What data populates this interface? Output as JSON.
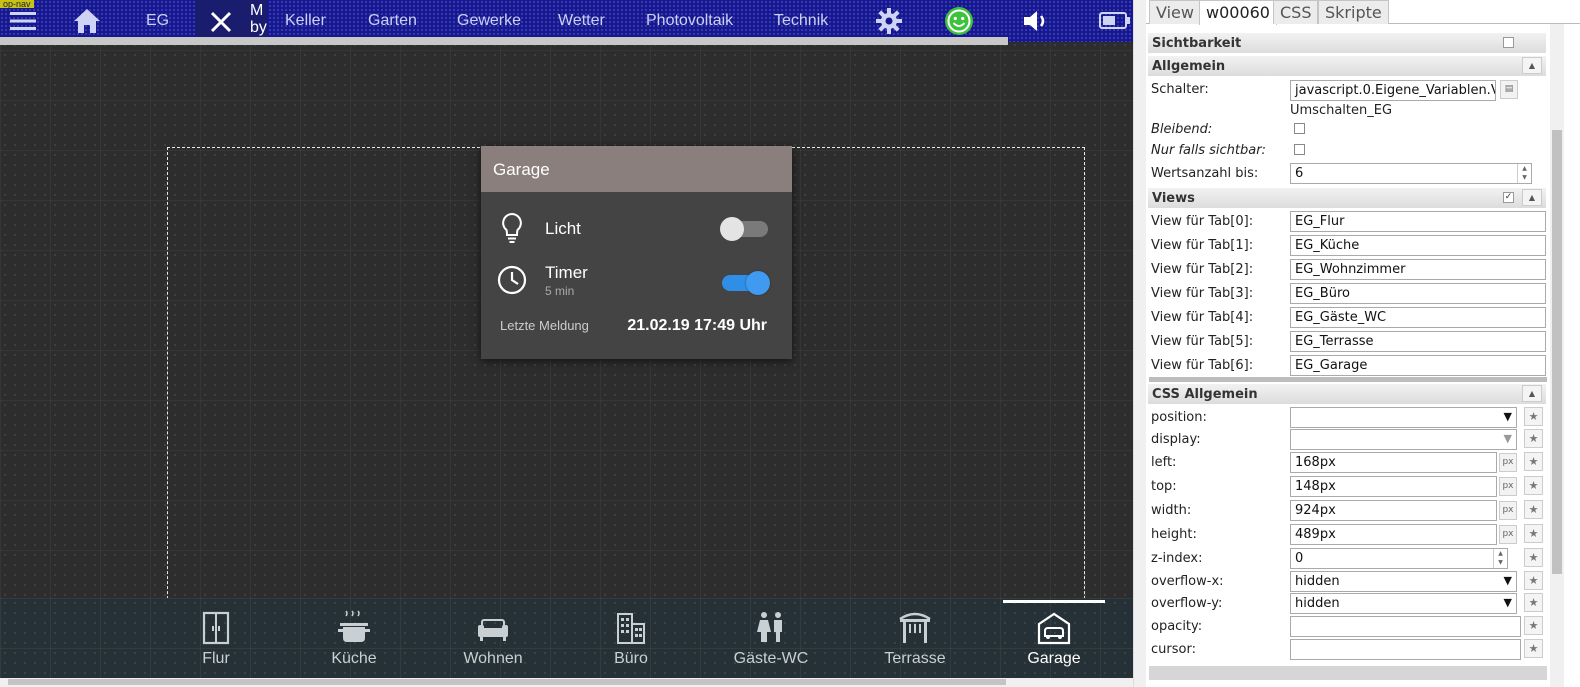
{
  "topnav": {
    "tag": "op-nav",
    "home_label": "EG",
    "close_text_line1": "M",
    "close_text_line2": "by",
    "links": [
      "Keller",
      "Garten",
      "Gewerke",
      "Wetter",
      "Photovoltaik",
      "Technik"
    ]
  },
  "card": {
    "title": "Garage",
    "licht_label": "Licht",
    "licht_on": false,
    "timer_label": "Timer",
    "timer_sub": "5 min",
    "timer_on": true,
    "meldung_label": "Letzte Meldung",
    "meldung_value": "21.02.19 17:49 Uhr"
  },
  "tabbar": {
    "tabs": [
      {
        "label": "Flur",
        "icon": "door-icon"
      },
      {
        "label": "Küche",
        "icon": "cooking-pot-icon"
      },
      {
        "label": "Wohnen",
        "icon": "sofa-icon"
      },
      {
        "label": "Büro",
        "icon": "office-building-icon"
      },
      {
        "label": "Gäste-WC",
        "icon": "restroom-icon"
      },
      {
        "label": "Terrasse",
        "icon": "pergola-icon"
      },
      {
        "label": "Garage",
        "icon": "garage-icon"
      }
    ],
    "active_index": 6
  },
  "panel": {
    "tabs": [
      "View",
      "w00060",
      "CSS",
      "Skripte"
    ],
    "active_tab": 1,
    "sichtbarkeit": "Sichtbarkeit",
    "allgemein": "Allgemein",
    "schalter_label": "Schalter:",
    "schalter_value": "javascript.0.Eigene_Variablen.V",
    "schalter_hint": "Umschalten_EG",
    "bleibend_label": "Bleibend:",
    "nur_sichtbar_label": "Nur falls sichtbar:",
    "wertsanzahl_label": "Wertsanzahl bis:",
    "wertsanzahl_value": "6",
    "views": "Views",
    "view_rows": [
      {
        "label": "View für Tab[0]:",
        "value": "EG_Flur"
      },
      {
        "label": "View für Tab[1]:",
        "value": "EG_Küche"
      },
      {
        "label": "View für Tab[2]:",
        "value": "EG_Wohnzimmer"
      },
      {
        "label": "View für Tab[3]:",
        "value": "EG_Büro"
      },
      {
        "label": "View für Tab[4]:",
        "value": "EG_Gäste_WC"
      },
      {
        "label": "View für Tab[5]:",
        "value": "EG_Terrasse"
      },
      {
        "label": "View für Tab[6]:",
        "value": "EG_Garage"
      }
    ],
    "css_allgemein": "CSS Allgemein",
    "css_rows": [
      {
        "label": "position:",
        "value": ""
      },
      {
        "label": "display:",
        "value": ""
      },
      {
        "label": "left:",
        "value": "168px",
        "unit": "px"
      },
      {
        "label": "top:",
        "value": "148px",
        "unit": "px"
      },
      {
        "label": "width:",
        "value": "924px",
        "unit": "px"
      },
      {
        "label": "height:",
        "value": "489px",
        "unit": "px"
      },
      {
        "label": "z-index:",
        "value": "0"
      },
      {
        "label": "overflow-x:",
        "value": "hidden"
      },
      {
        "label": "overflow-y:",
        "value": "hidden"
      },
      {
        "label": "opacity:",
        "value": ""
      },
      {
        "label": "cursor:",
        "value": ""
      }
    ]
  },
  "colors": {
    "nav_bg": "#17188e",
    "card_header": "#8b7f7d",
    "toggle_on": "#2f8ee6",
    "smiley": "#3cc23c"
  }
}
